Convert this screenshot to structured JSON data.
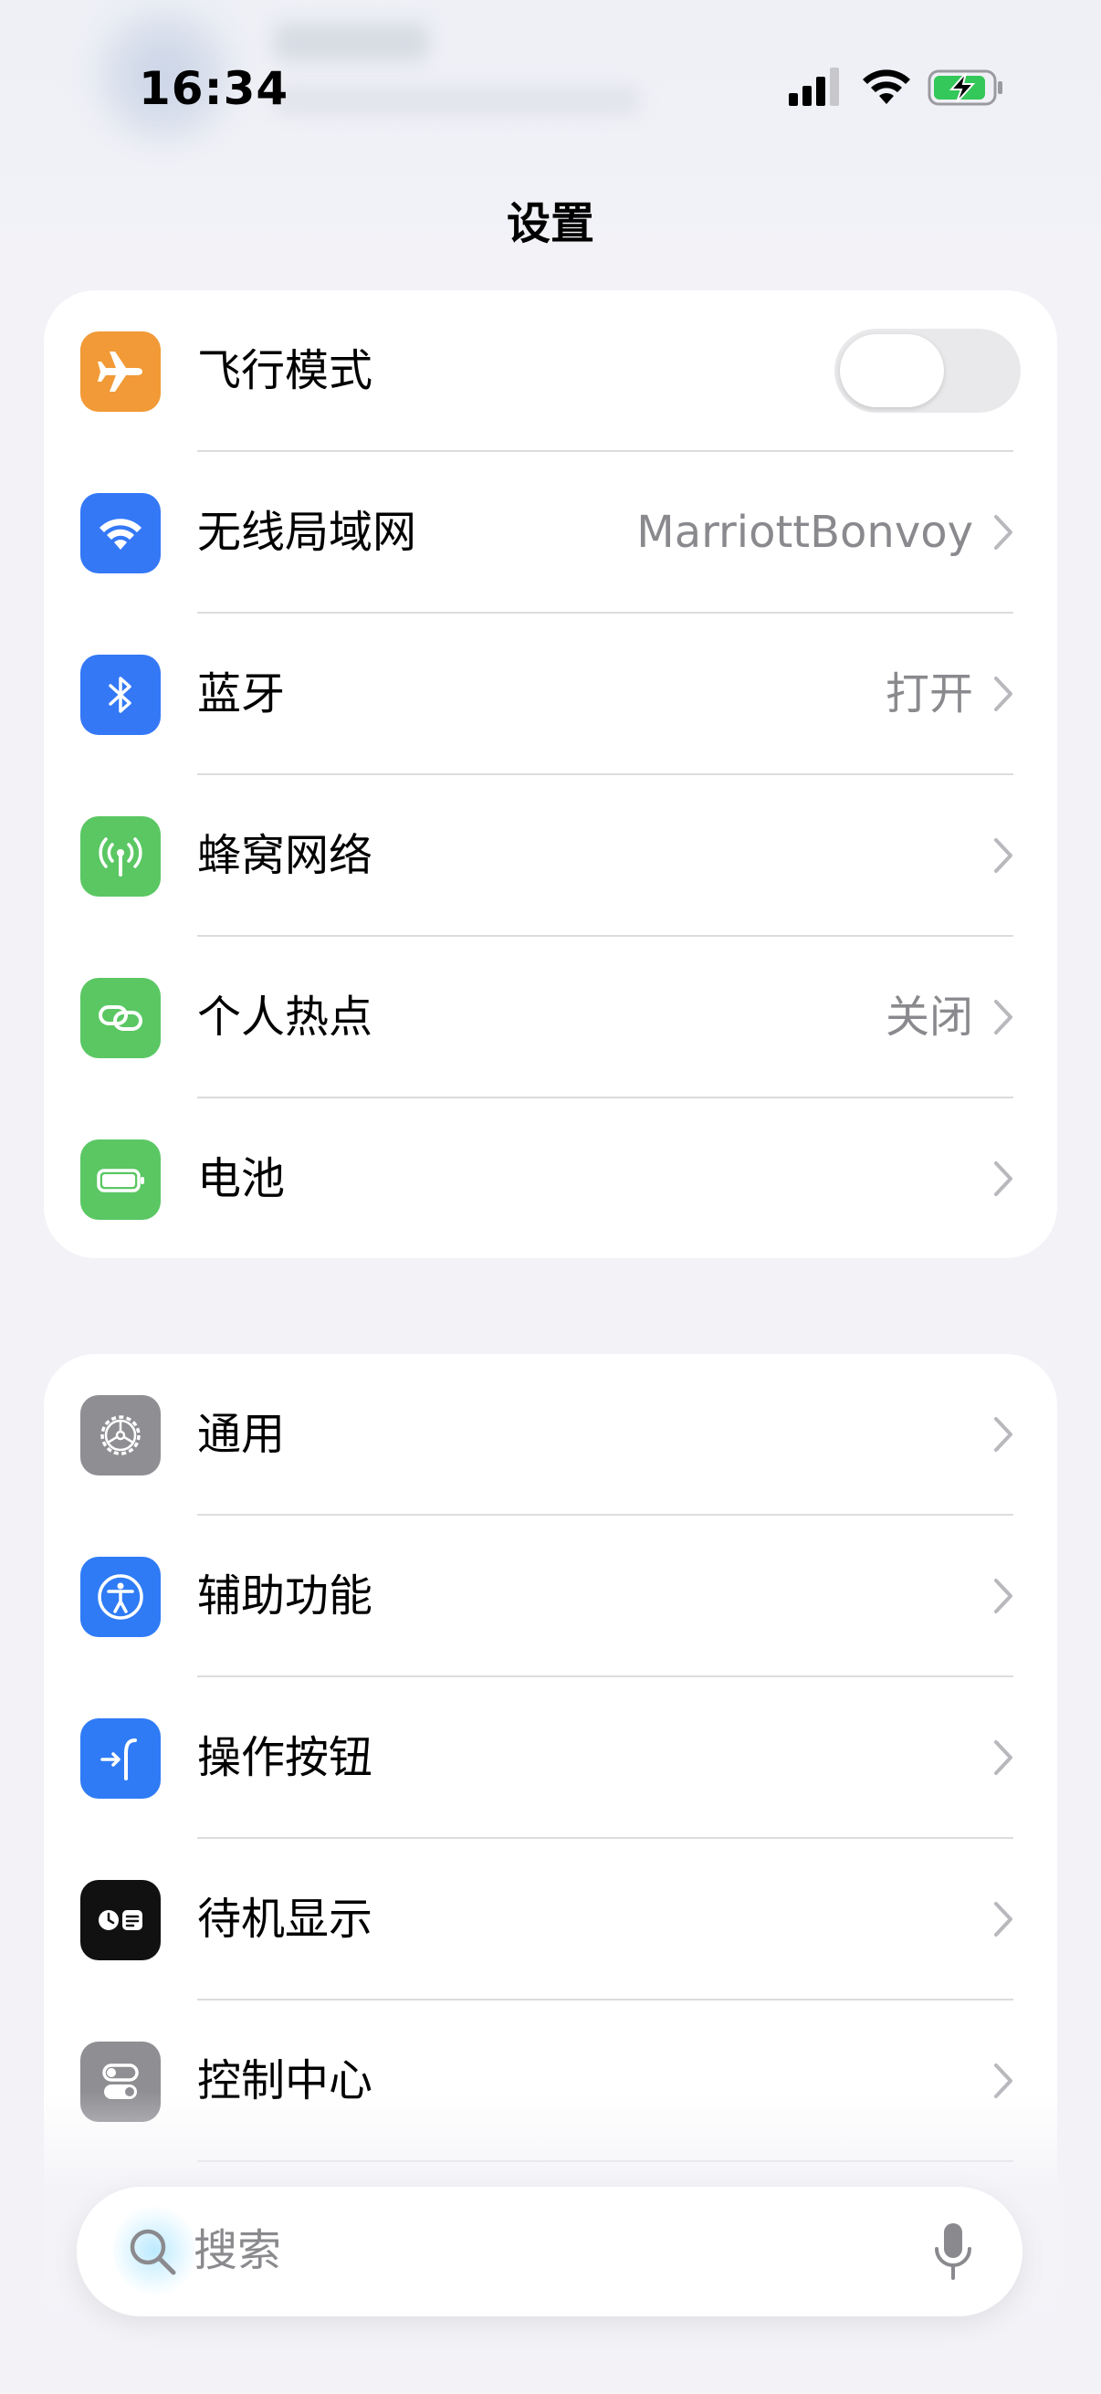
{
  "status_bar": {
    "time": "16:34"
  },
  "title": "设置",
  "groups": [
    {
      "rows": [
        {
          "label": "飞行模式",
          "icon": "airplane-icon",
          "icon_color": "#f19a37",
          "control": "toggle",
          "toggle_on": false
        },
        {
          "label": "无线局域网",
          "value": "MarriottBonvoy",
          "icon": "wifi-icon",
          "icon_color": "#3478f6"
        },
        {
          "label": "蓝牙",
          "value": "打开",
          "icon": "bluetooth-icon",
          "icon_color": "#3478f6"
        },
        {
          "label": "蜂窝网络",
          "value": "",
          "icon": "antenna-icon",
          "icon_color": "#5ac763"
        },
        {
          "label": "个人热点",
          "value": "关闭",
          "icon": "link-icon",
          "icon_color": "#5ac763"
        },
        {
          "label": "电池",
          "value": "",
          "icon": "battery-full-icon",
          "icon_color": "#5ac763"
        }
      ]
    },
    {
      "rows": [
        {
          "label": "通用",
          "icon": "gear-icon",
          "icon_color": "#8e8e93"
        },
        {
          "label": "辅助功能",
          "icon": "accessibility-icon",
          "icon_color": "#2f7bf5"
        },
        {
          "label": "操作按钮",
          "icon": "action-button-icon",
          "icon_color": "#2f7bf5"
        },
        {
          "label": "待机显示",
          "icon": "standby-icon",
          "icon_color": "#111111"
        },
        {
          "label": "控制中心",
          "icon": "switches-icon",
          "icon_color": "#8e8e93"
        }
      ]
    }
  ],
  "search": {
    "placeholder": "搜索"
  },
  "colors": {
    "background": "#f2f2f7",
    "separator": "#dcdcdf",
    "secondary_text": "#8a8a8e",
    "battery_charging": "#34c759"
  }
}
